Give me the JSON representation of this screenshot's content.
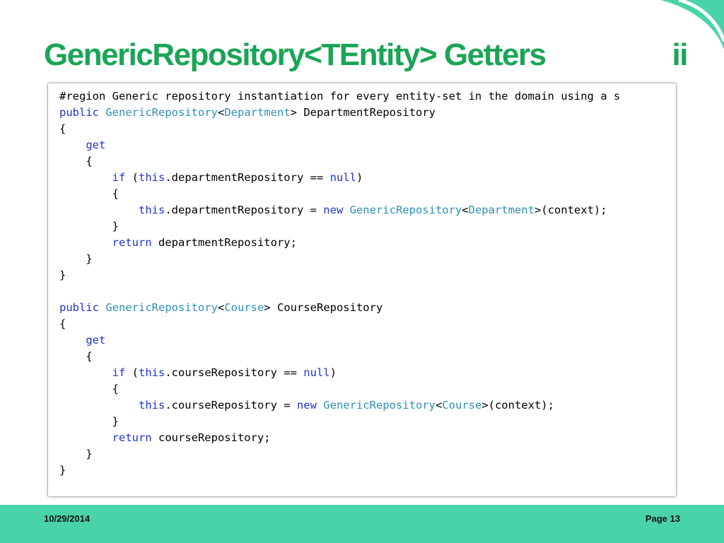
{
  "slide": {
    "title": "GenericRepository<TEntity> Getters",
    "title_suffix": "ii",
    "date": "10/29/2014",
    "page": "Page 13"
  },
  "colors": {
    "title": "#1aa556",
    "footer": "#48d4a8",
    "keyword": "#1f33d6",
    "type": "#2e8fb8"
  },
  "code": {
    "lines": [
      [
        {
          "t": "#region Generic repository instantiation for every entity-set in the domain using a s",
          "c": ""
        }
      ],
      [
        {
          "t": "public",
          "c": "kw"
        },
        {
          "t": " ",
          "c": ""
        },
        {
          "t": "GenericRepository",
          "c": "ty"
        },
        {
          "t": "<",
          "c": ""
        },
        {
          "t": "Department",
          "c": "ty"
        },
        {
          "t": "> DepartmentRepository",
          "c": ""
        }
      ],
      [
        {
          "t": "{",
          "c": ""
        }
      ],
      [
        {
          "t": "    ",
          "c": ""
        },
        {
          "t": "get",
          "c": "kw"
        }
      ],
      [
        {
          "t": "    {",
          "c": ""
        }
      ],
      [
        {
          "t": "        ",
          "c": ""
        },
        {
          "t": "if",
          "c": "kw"
        },
        {
          "t": " (",
          "c": ""
        },
        {
          "t": "this",
          "c": "kw"
        },
        {
          "t": ".departmentRepository == ",
          "c": ""
        },
        {
          "t": "null",
          "c": "kw"
        },
        {
          "t": ")",
          "c": ""
        }
      ],
      [
        {
          "t": "        {",
          "c": ""
        }
      ],
      [
        {
          "t": "            ",
          "c": ""
        },
        {
          "t": "this",
          "c": "kw"
        },
        {
          "t": ".departmentRepository = ",
          "c": ""
        },
        {
          "t": "new",
          "c": "kw"
        },
        {
          "t": " ",
          "c": ""
        },
        {
          "t": "GenericRepository",
          "c": "ty"
        },
        {
          "t": "<",
          "c": ""
        },
        {
          "t": "Department",
          "c": "ty"
        },
        {
          "t": ">(context);",
          "c": ""
        }
      ],
      [
        {
          "t": "        }",
          "c": ""
        }
      ],
      [
        {
          "t": "        ",
          "c": ""
        },
        {
          "t": "return",
          "c": "kw"
        },
        {
          "t": " departmentRepository;",
          "c": ""
        }
      ],
      [
        {
          "t": "    }",
          "c": ""
        }
      ],
      [
        {
          "t": "}",
          "c": ""
        }
      ],
      [],
      [
        {
          "t": "public",
          "c": "kw"
        },
        {
          "t": " ",
          "c": ""
        },
        {
          "t": "GenericRepository",
          "c": "ty"
        },
        {
          "t": "<",
          "c": ""
        },
        {
          "t": "Course",
          "c": "ty"
        },
        {
          "t": "> CourseRepository",
          "c": ""
        }
      ],
      [
        {
          "t": "{",
          "c": ""
        }
      ],
      [
        {
          "t": "    ",
          "c": ""
        },
        {
          "t": "get",
          "c": "kw"
        }
      ],
      [
        {
          "t": "    {",
          "c": ""
        }
      ],
      [
        {
          "t": "        ",
          "c": ""
        },
        {
          "t": "if",
          "c": "kw"
        },
        {
          "t": " (",
          "c": ""
        },
        {
          "t": "this",
          "c": "kw"
        },
        {
          "t": ".courseRepository == ",
          "c": ""
        },
        {
          "t": "null",
          "c": "kw"
        },
        {
          "t": ")",
          "c": ""
        }
      ],
      [
        {
          "t": "        {",
          "c": ""
        }
      ],
      [
        {
          "t": "            ",
          "c": ""
        },
        {
          "t": "this",
          "c": "kw"
        },
        {
          "t": ".courseRepository = ",
          "c": ""
        },
        {
          "t": "new",
          "c": "kw"
        },
        {
          "t": " ",
          "c": ""
        },
        {
          "t": "GenericRepository",
          "c": "ty"
        },
        {
          "t": "<",
          "c": ""
        },
        {
          "t": "Course",
          "c": "ty"
        },
        {
          "t": ">(context);",
          "c": ""
        }
      ],
      [
        {
          "t": "        }",
          "c": ""
        }
      ],
      [
        {
          "t": "        ",
          "c": ""
        },
        {
          "t": "return",
          "c": "kw"
        },
        {
          "t": " courseRepository;",
          "c": ""
        }
      ],
      [
        {
          "t": "    }",
          "c": ""
        }
      ],
      [
        {
          "t": "}",
          "c": ""
        }
      ]
    ]
  }
}
